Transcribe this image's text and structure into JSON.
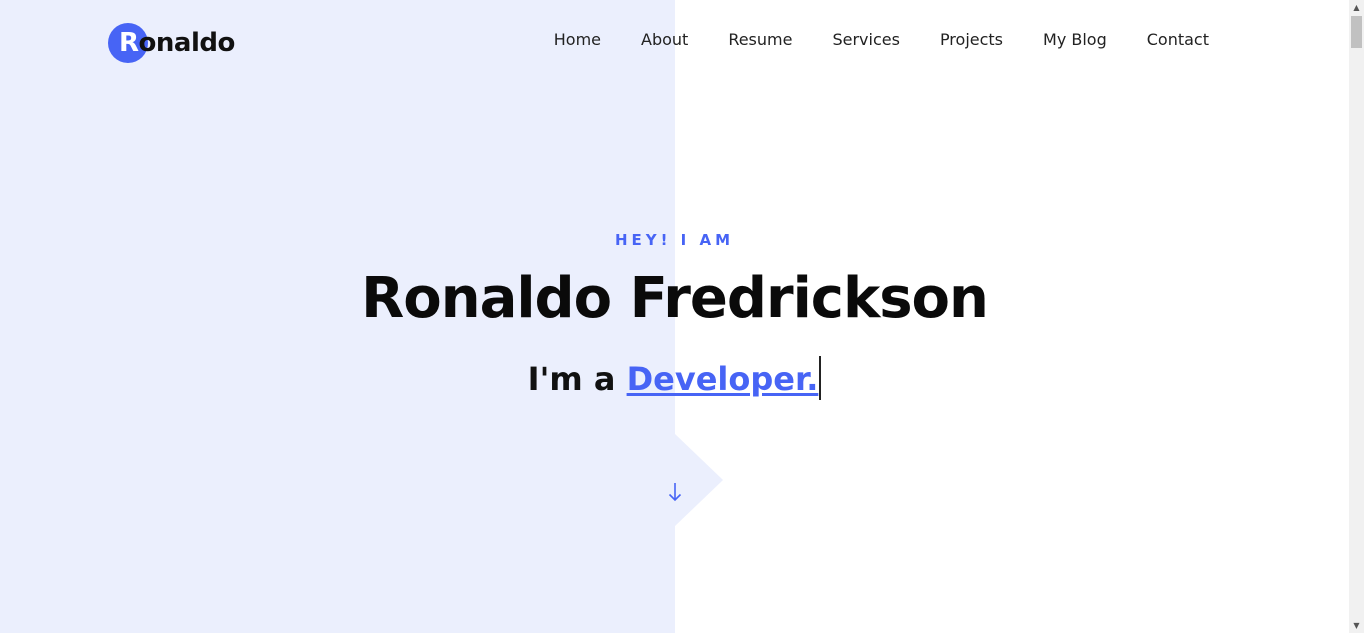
{
  "header": {
    "logo": {
      "first_letter": "R",
      "rest": "onaldo"
    },
    "nav": [
      "Home",
      "About",
      "Resume",
      "Services",
      "Projects",
      "My Blog",
      "Contact"
    ]
  },
  "hero": {
    "greeting": "HEY! I AM",
    "name": "Ronaldo Fredrickson",
    "tagline_prefix": "I'm a",
    "tagline_role": "Developer."
  },
  "icons": {
    "scroll_down": "arrow-down-icon"
  },
  "colors": {
    "accent": "#4764f5",
    "panel": "#ebeffd",
    "text": "#0a0a0a"
  }
}
